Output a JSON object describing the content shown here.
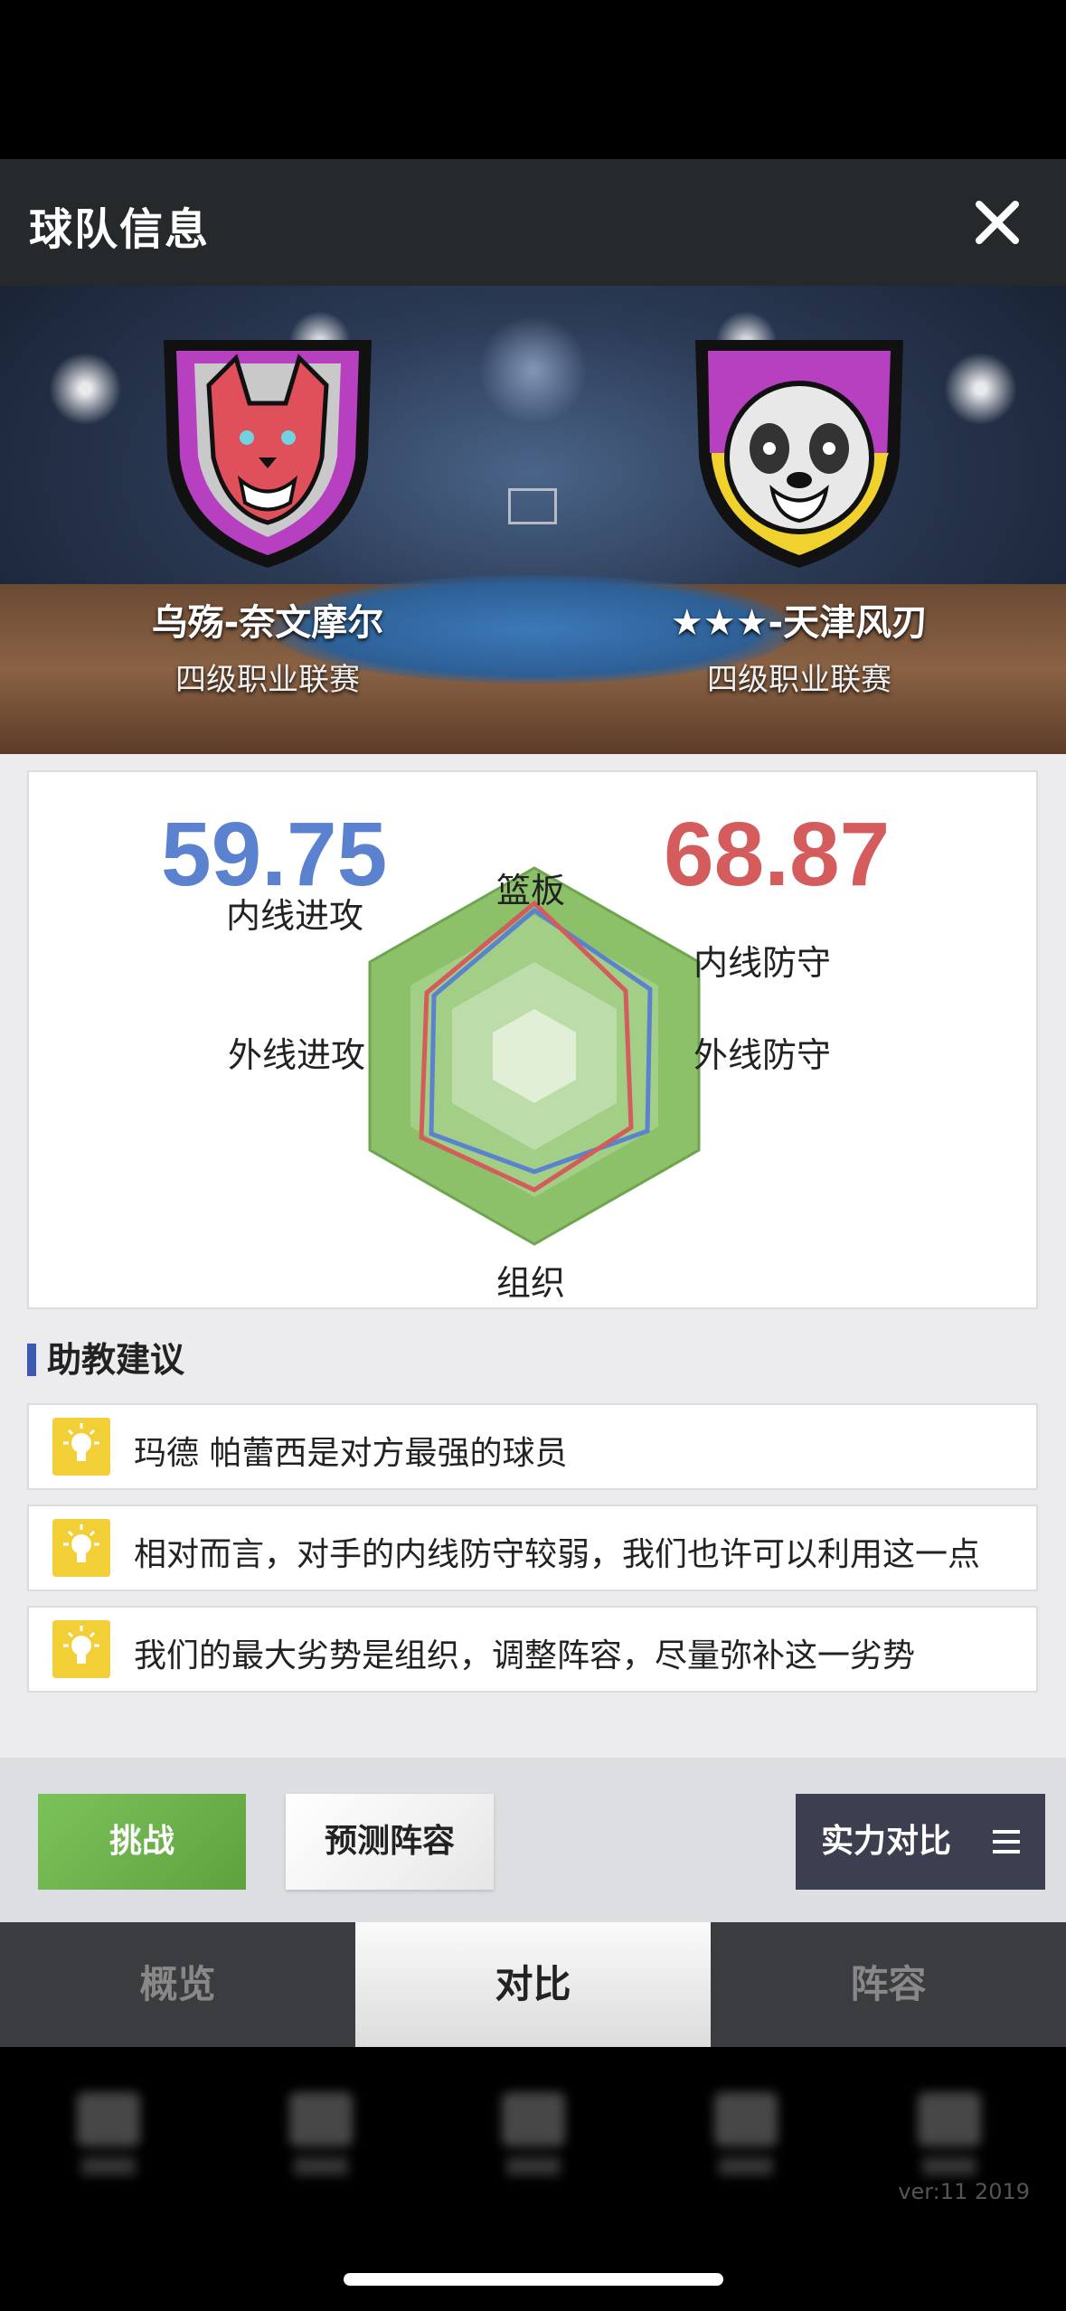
{
  "header": {
    "title": "球队信息",
    "close_icon": "close-icon"
  },
  "teams": {
    "home": {
      "name": "乌殇-奈文摩尔",
      "league": "四级职业联赛",
      "crest": "wolf-crest"
    },
    "away": {
      "name": "★★★-天津风刃",
      "league": "四级职业联赛",
      "crest": "panda-crest"
    }
  },
  "comparison": {
    "home_score": "59.75",
    "away_score": "68.87",
    "labels": {
      "top": "篮板",
      "upper_right": "内线防守",
      "lower_right": "外线防守",
      "bottom": "组织",
      "lower_left": "外线进攻",
      "upper_left": "内线进攻"
    },
    "colors": {
      "home": "#5a82cf",
      "away": "#d45c5c",
      "radar_fill": "#8cc16a"
    }
  },
  "advice": {
    "title": "助教建议",
    "items": [
      "玛德 帕蕾西是对方最强的球员",
      "相对而言，对手的内线防守较弱，我们也许可以利用这一点",
      "我们的最大劣势是组织，调整阵容，尽量弥补这一劣势"
    ]
  },
  "actions": {
    "challenge": "挑战",
    "predict": "预测阵容",
    "strength": "实力对比"
  },
  "tabs": [
    {
      "label": "概览"
    },
    {
      "label": "对比"
    },
    {
      "label": "阵容"
    }
  ],
  "version": "ver:11  2019"
}
